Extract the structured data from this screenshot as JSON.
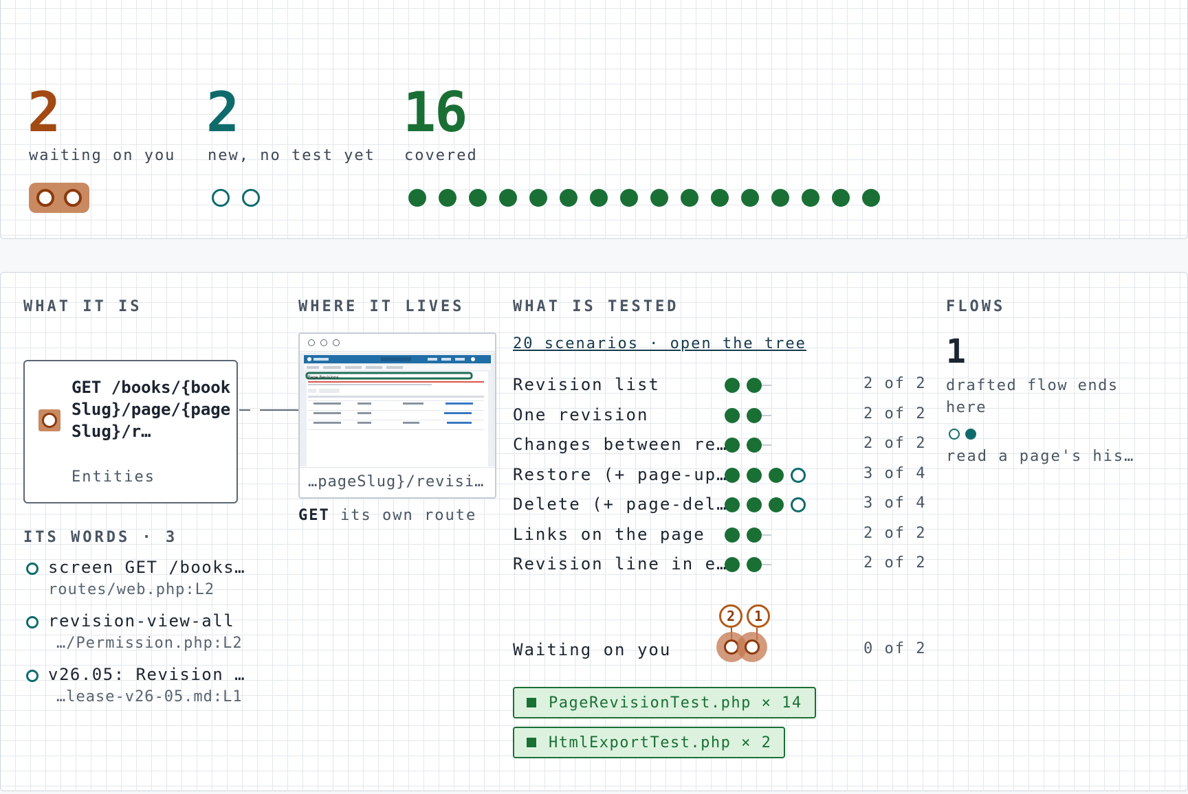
{
  "stats": {
    "waiting": {
      "value": "2",
      "label": "waiting on you",
      "color": "#8b3a0c"
    },
    "new": {
      "value": "2",
      "label": "new, no test yet",
      "color": "#0f6b6b"
    },
    "covered": {
      "value": "16",
      "label": "covered",
      "color": "#1a6f35"
    }
  },
  "columns": {
    "what_it_is": "WHAT IT IS",
    "where_it_lives": "WHERE IT LIVES",
    "what_is_tested": "WHAT IS TESTED",
    "flows": "FLOWS"
  },
  "entity": {
    "route": "GET /books/{bookSlug}/page/{pageSlug}/r…",
    "kind": "Entities"
  },
  "words": {
    "heading": "ITS WORDS · 3",
    "items": [
      {
        "text": "screen GET /books…",
        "source": "routes/web.php:L2"
      },
      {
        "text": "revision-view-all",
        "source": "…/Permission.php:L2"
      },
      {
        "text": "v26.05: Revision …",
        "source": "…lease-v26-05.md:L1"
      }
    ]
  },
  "where": {
    "caption": "…pageSlug}/revisi…",
    "method": "GET",
    "own_route": "its own route",
    "mini": {
      "title": "Page Revisions"
    }
  },
  "tested": {
    "tree_link": "20 scenarios · open the tree",
    "scenarios": [
      {
        "name": "Revision list",
        "passed": 2,
        "total": 2,
        "count": "2 of 2"
      },
      {
        "name": "One revision",
        "passed": 2,
        "total": 2,
        "count": "2 of 2"
      },
      {
        "name": "Changes between re…",
        "passed": 2,
        "total": 2,
        "count": "2 of 2"
      },
      {
        "name": "Restore (+ page-up…",
        "passed": 3,
        "total": 4,
        "count": "3 of 4"
      },
      {
        "name": "Delete (+ page-del…",
        "passed": 3,
        "total": 4,
        "count": "3 of 4"
      },
      {
        "name": "Links on the page",
        "passed": 2,
        "total": 2,
        "count": "2 of 2"
      },
      {
        "name": "Revision line in e…",
        "passed": 2,
        "total": 2,
        "count": "2 of 2"
      }
    ],
    "waiting": {
      "name": "Waiting on you",
      "count": "0 of 2",
      "tags": [
        "2",
        "1"
      ]
    },
    "files": [
      {
        "name": "PageRevisionTest.php × 14"
      },
      {
        "name": "HtmlExportTest.php × 2"
      }
    ]
  },
  "flows": {
    "count": "1",
    "description": "drafted flow ends here",
    "step": "read a page's his…"
  }
}
